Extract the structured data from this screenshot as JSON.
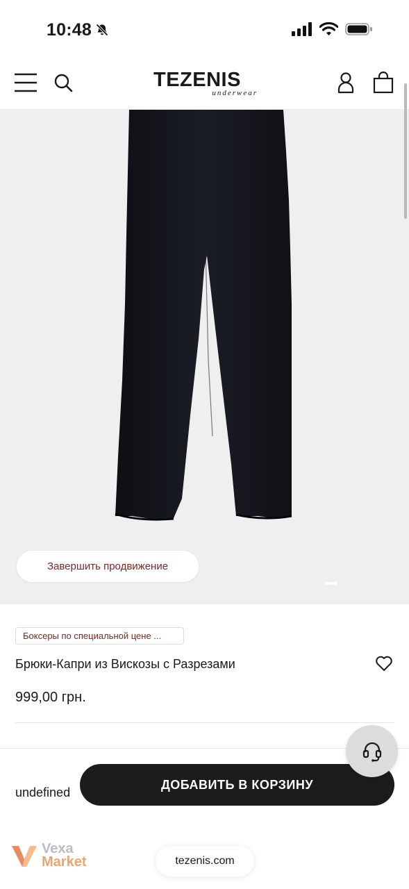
{
  "status_bar": {
    "time": "10:48"
  },
  "header": {
    "logo_main": "TEZENIS",
    "logo_sub": "underwear"
  },
  "gallery": {
    "promo_pill_label": "Завершить продвижение",
    "current_slide": 1
  },
  "product": {
    "promo_badge": "Боксеры по специальной цене ...",
    "title": "Брюки-Капри из Вискозы с Разрезами",
    "price": "999,00 грн.",
    "color": "#14161c"
  },
  "buy_bar": {
    "variant_text": "undefined",
    "add_to_cart_label": "ДОБАВИТЬ В КОРЗИНУ"
  },
  "watermark": {
    "line1": "Vexa",
    "line2": "Market"
  },
  "browser": {
    "url": "tezenis.com"
  },
  "colors": {
    "accent_text": "#7a2a22",
    "button_dark": "#1c1c1c",
    "gallery_bg": "#efefef"
  }
}
